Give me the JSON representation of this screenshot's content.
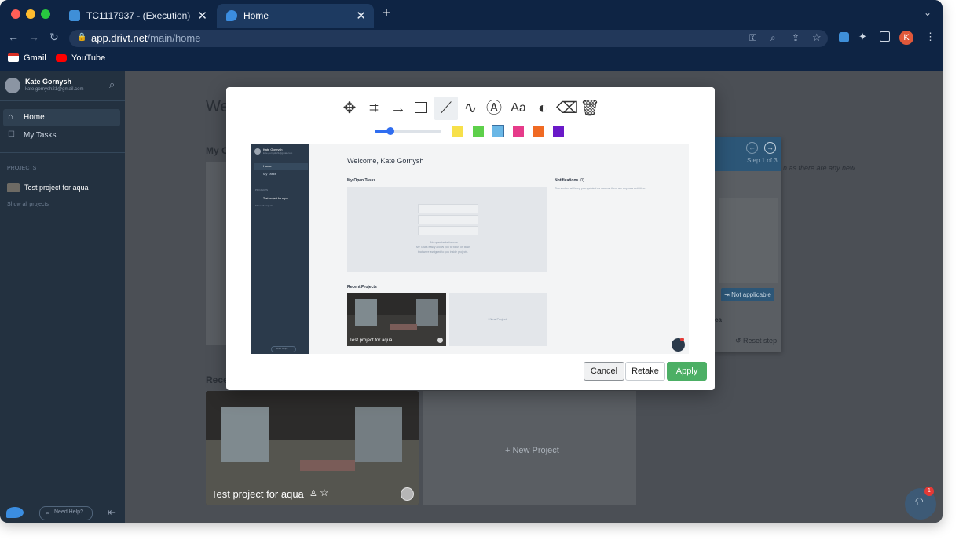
{
  "browser": {
    "tabs": [
      {
        "title": "TC1117937 - (Execution)"
      },
      {
        "title": "Home"
      }
    ],
    "new_tab": "+",
    "url": {
      "host": "app.drivt.net",
      "path": "/main/home"
    },
    "bookmarks": [
      {
        "label": "Gmail"
      },
      {
        "label": "YouTube"
      }
    ],
    "profile_initial": "K"
  },
  "sidebar": {
    "user_name": "Kate Gornysh",
    "user_email": "kate.gornysh21@gmail.com",
    "nav": [
      {
        "label": "Home",
        "active": true
      },
      {
        "label": "My Tasks",
        "active": false
      }
    ],
    "projects_heading": "PROJECTS",
    "projects": [
      {
        "label": "Test project for aqua"
      }
    ],
    "show_all": "Show all projects",
    "need_help": "Need Help?"
  },
  "main": {
    "welcome_partial": "We",
    "open_tasks_partial": "My O",
    "recent_partial": "Rece",
    "project_card_title": "Test project for aqua",
    "new_project": "+ New Project",
    "notification_count": "1"
  },
  "side_panel": {
    "step": "Step 1 of 3",
    "text_partial": "n as there are any new",
    "not_applicable": "Not applicable",
    "area_partial": "ea",
    "reset": "Reset step"
  },
  "modal": {
    "tools": [
      "move-icon",
      "crop-icon",
      "arrow-icon",
      "rectangle-icon",
      "line-icon",
      "freehand-icon",
      "stamp-icon",
      "text-icon",
      "blur-icon",
      "eraser-icon",
      "trash-icon"
    ],
    "text_tool_label": "Aa",
    "colors": [
      "#f7e04a",
      "#5ed04b",
      "#6ab7e6",
      "#e63b8a",
      "#f06a23",
      "#6a19c8"
    ],
    "brush_size": 0.24,
    "cancel": "Cancel",
    "retake": "Retake",
    "apply": "Apply",
    "preview": {
      "user_name": "Kate Gornysh",
      "user_email": "kate.gornysh21@gmail.com",
      "nav": [
        "Home",
        "My Tasks"
      ],
      "projects_heading": "PROJECTS",
      "project": "Test project for aqua",
      "show_all": "Show all projects",
      "need_help": "Need Help?",
      "welcome": "Welcome, Kate Gornysh",
      "open_tasks": "My Open Tasks",
      "notifications": "Notifications",
      "notifications_count": "(0)",
      "notifications_text": "This section will keep you updated as soon as there are any new activities.",
      "empty_line1": "No open tasks for now.",
      "empty_line2": "My Tasks easily allows you to focus on tasks",
      "empty_line3": "that were assigned to you inside projects.",
      "recent_projects": "Recent Projects",
      "project_card": "Test project for aqua",
      "new_project": "+ New Project"
    }
  }
}
